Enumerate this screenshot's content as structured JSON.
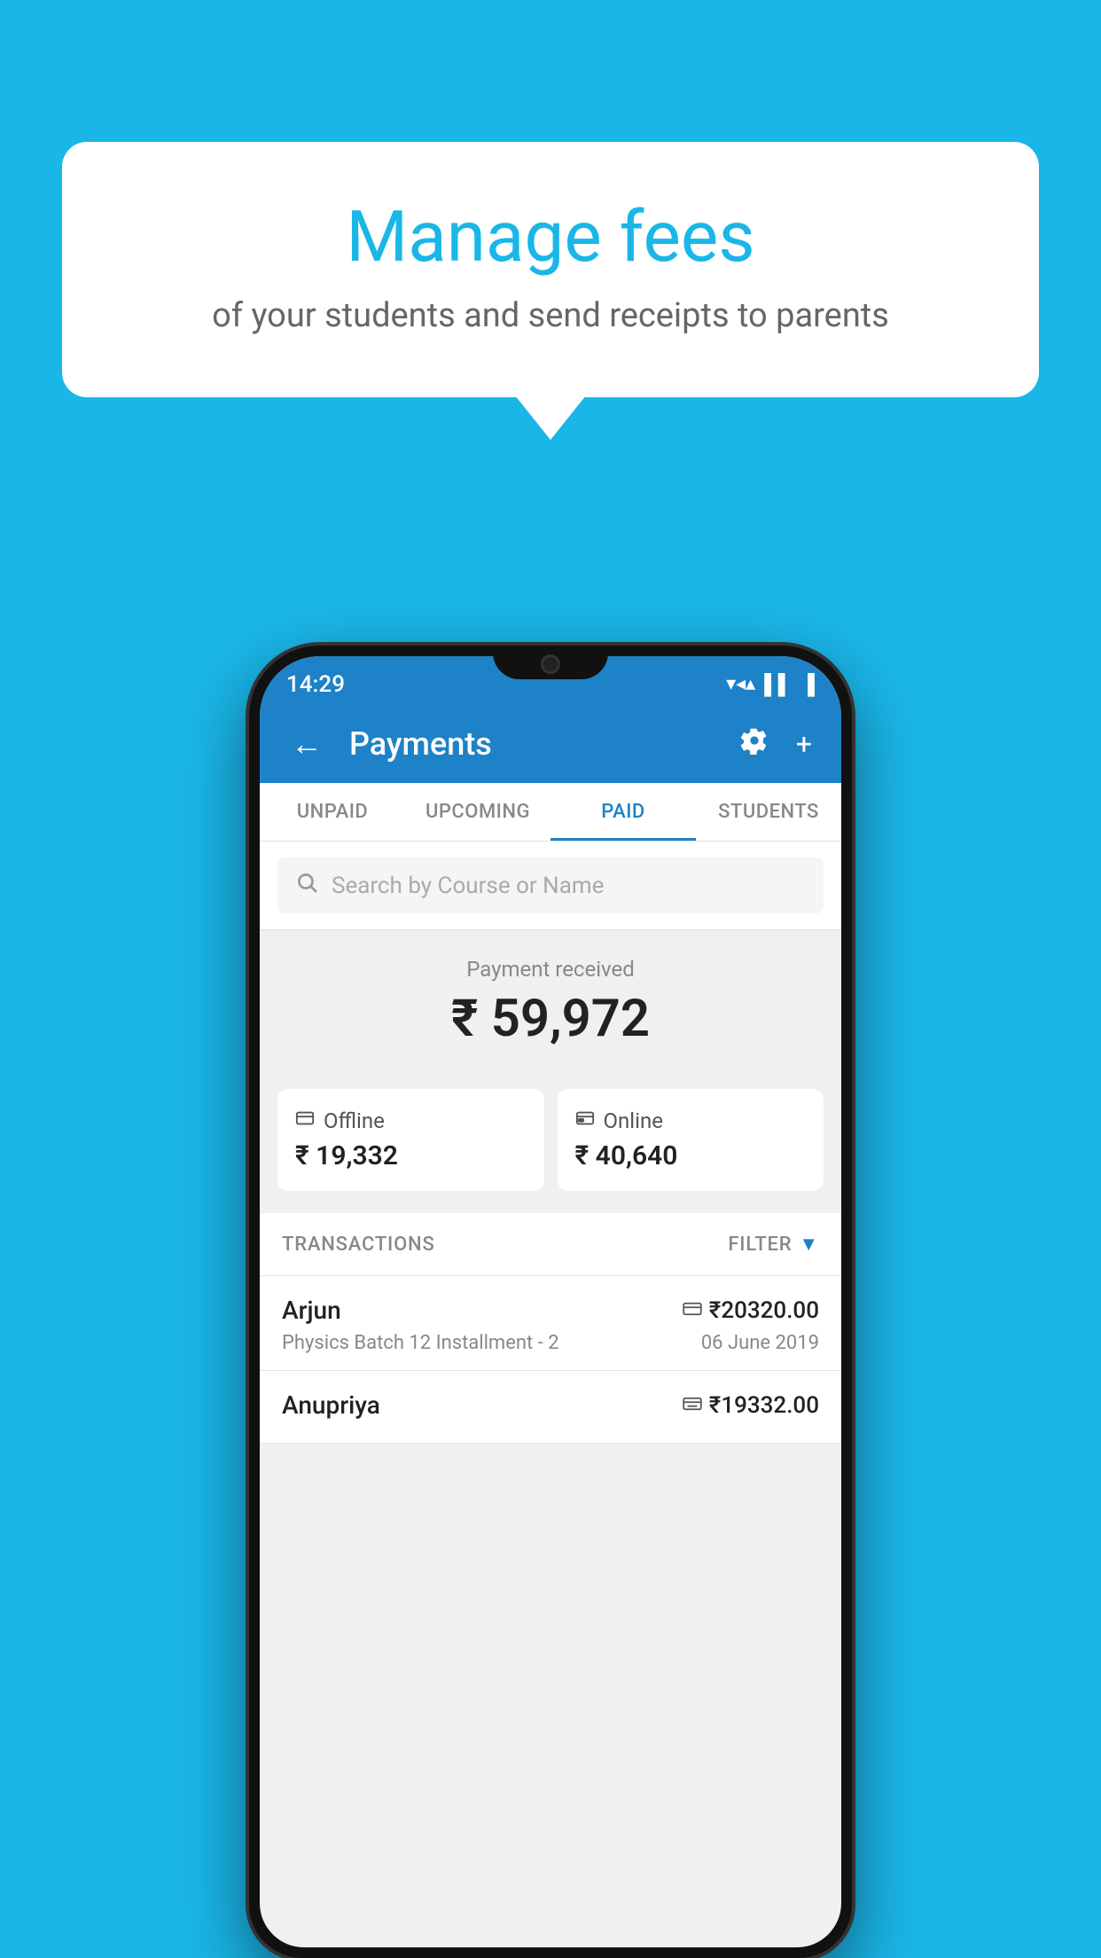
{
  "page": {
    "background_color": "#1ab6e8"
  },
  "speech_bubble": {
    "title": "Manage fees",
    "subtitle": "of your students and send receipts to parents"
  },
  "status_bar": {
    "time": "14:29",
    "icons": [
      "wifi",
      "signal",
      "battery"
    ]
  },
  "app_bar": {
    "title": "Payments",
    "back_label": "←",
    "settings_label": "⚙",
    "add_label": "+"
  },
  "tabs": [
    {
      "label": "UNPAID",
      "active": false
    },
    {
      "label": "UPCOMING",
      "active": false
    },
    {
      "label": "PAID",
      "active": true
    },
    {
      "label": "STUDENTS",
      "active": false
    }
  ],
  "search": {
    "placeholder": "Search by Course or Name"
  },
  "payment_received": {
    "label": "Payment received",
    "amount": "₹ 59,972"
  },
  "payment_cards": {
    "offline": {
      "label": "Offline",
      "amount": "₹ 19,332",
      "icon": "📋"
    },
    "online": {
      "label": "Online",
      "amount": "₹ 40,640",
      "icon": "💳"
    }
  },
  "transactions_section": {
    "header": "TRANSACTIONS",
    "filter_label": "FILTER"
  },
  "transactions": [
    {
      "name": "Arjun",
      "description": "Physics Batch 12 Installment - 2",
      "amount": "₹20320.00",
      "date": "06 June 2019",
      "payment_type": "online"
    },
    {
      "name": "Anupriya",
      "description": "",
      "amount": "₹19332.00",
      "date": "",
      "payment_type": "offline"
    }
  ]
}
